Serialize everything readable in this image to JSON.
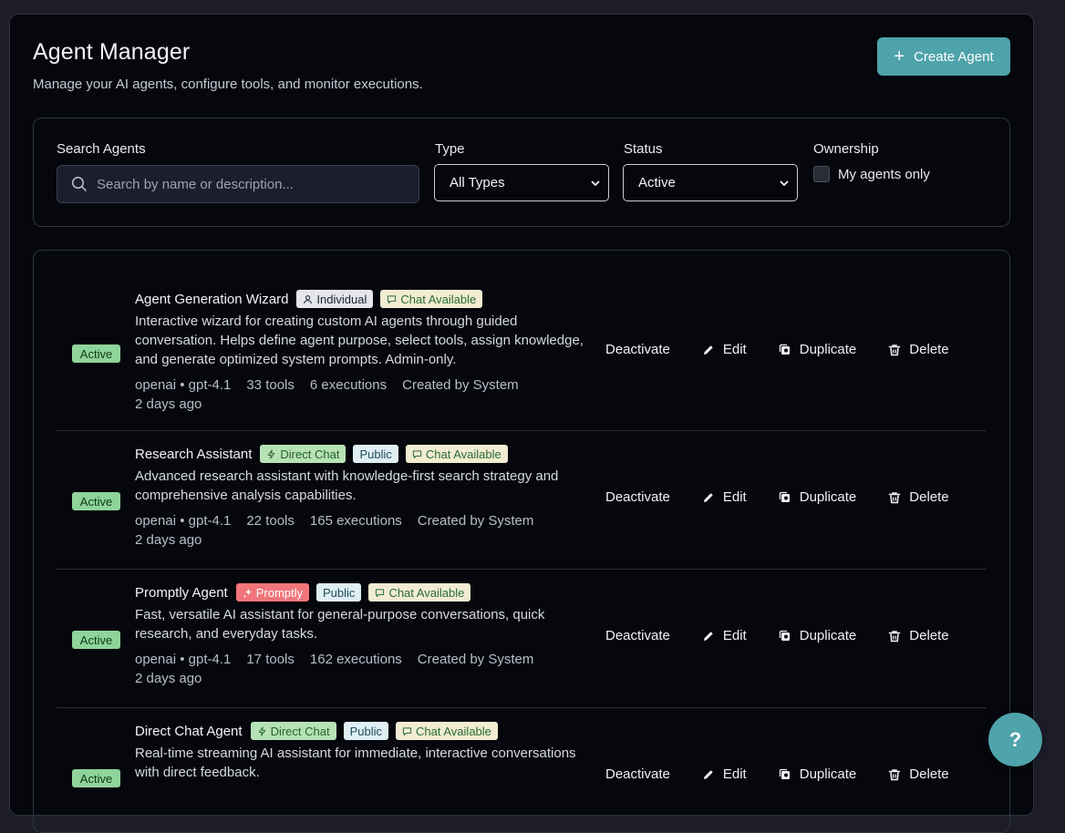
{
  "header": {
    "title": "Agent Manager",
    "subtitle": "Manage your AI agents, configure tools, and monitor executions.",
    "create_label": "Create Agent"
  },
  "filters": {
    "search_label": "Search Agents",
    "search_placeholder": "Search by name or description...",
    "type_label": "Type",
    "type_value": "All Types",
    "status_label": "Status",
    "status_value": "Active",
    "ownership_label": "Ownership",
    "ownership_checkbox_label": "My agents only"
  },
  "actions": {
    "deactivate": "Deactivate",
    "edit": "Edit",
    "duplicate": "Duplicate",
    "delete": "Delete"
  },
  "agents": [
    {
      "status": "Active",
      "name": "Agent Generation Wizard",
      "badges": [
        {
          "label": "Individual",
          "icon": "user-icon",
          "kind": "ind"
        },
        {
          "label": "Chat Available",
          "icon": "chat-bubble-icon",
          "kind": "chat"
        }
      ],
      "description": "Interactive wizard for creating custom AI agents through guided conversation. Helps define agent purpose, select tools, assign knowledge, and generate optimized system prompts. Admin-only.",
      "model": "openai • gpt-4.1",
      "tools": "33 tools",
      "executions": "6 executions",
      "created_by": "Created by System",
      "ago": "2 days ago"
    },
    {
      "status": "Active",
      "name": "Research Assistant",
      "badges": [
        {
          "label": "Direct Chat",
          "icon": "bolt-icon",
          "kind": "direct"
        },
        {
          "label": "Public",
          "icon": "",
          "kind": "public"
        },
        {
          "label": "Chat Available",
          "icon": "chat-bubble-icon",
          "kind": "chat"
        }
      ],
      "description": "Advanced research assistant with knowledge-first search strategy and comprehensive analysis capabilities.",
      "model": "openai • gpt-4.1",
      "tools": "22 tools",
      "executions": "165 executions",
      "created_by": "Created by System",
      "ago": "2 days ago"
    },
    {
      "status": "Active",
      "name": "Promptly Agent",
      "badges": [
        {
          "label": "Promptly",
          "icon": "sparkle-icon",
          "kind": "promptly"
        },
        {
          "label": "Public",
          "icon": "",
          "kind": "public"
        },
        {
          "label": "Chat Available",
          "icon": "chat-bubble-icon",
          "kind": "chat"
        }
      ],
      "description": "Fast, versatile AI assistant for general-purpose conversations, quick research, and everyday tasks.",
      "model": "openai • gpt-4.1",
      "tools": "17 tools",
      "executions": "162 executions",
      "created_by": "Created by System",
      "ago": "2 days ago"
    },
    {
      "status": "Active",
      "name": "Direct Chat Agent",
      "badges": [
        {
          "label": "Direct Chat",
          "icon": "bolt-icon",
          "kind": "direct"
        },
        {
          "label": "Public",
          "icon": "",
          "kind": "public"
        },
        {
          "label": "Chat Available",
          "icon": "chat-bubble-icon",
          "kind": "chat"
        }
      ],
      "description": "Real-time streaming AI assistant for immediate, interactive conversations with direct feedback."
    }
  ],
  "help_label": "?",
  "colors": {
    "accent": "#4fa3ab",
    "background": "#05070d",
    "status_active": "#8fd49a",
    "promptly": "#f0757a"
  }
}
